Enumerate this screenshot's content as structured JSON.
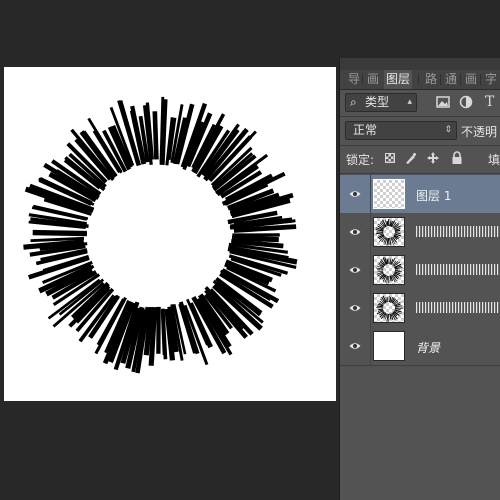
{
  "panel": {
    "tabs": [
      {
        "label": "导",
        "active": false
      },
      {
        "label": "画",
        "active": false
      },
      {
        "label": "图层",
        "active": true
      },
      {
        "label": "路",
        "active": false
      },
      {
        "label": "通",
        "active": false
      },
      {
        "label": "画",
        "active": false
      },
      {
        "label": "字",
        "active": false
      }
    ],
    "filter": {
      "search_glyph": "⌕",
      "label": "类型"
    },
    "filter_icons": [
      "image-icon",
      "adjustment-icon",
      "text-icon"
    ],
    "text_icon_glyph": "T",
    "blend_mode": "正常",
    "opacity_label": "不透明",
    "lock_label": "锁定:",
    "fill_label": "填",
    "layers": [
      {
        "name": "图层 1",
        "selected": true,
        "visible": true,
        "thumb": "transparent"
      },
      {
        "name": "",
        "selected": false,
        "visible": true,
        "thumb": "burst"
      },
      {
        "name": "",
        "selected": false,
        "visible": true,
        "thumb": "burst"
      },
      {
        "name": "",
        "selected": false,
        "visible": true,
        "thumb": "burst"
      },
      {
        "name": "背景",
        "selected": false,
        "visible": true,
        "thumb": "white",
        "italic": true
      }
    ]
  },
  "colors": {
    "workspace": "#282828",
    "panel": "#535353",
    "selected_layer": "#6b7b91",
    "canvas": "#ffffff",
    "stroke": "#000000"
  }
}
